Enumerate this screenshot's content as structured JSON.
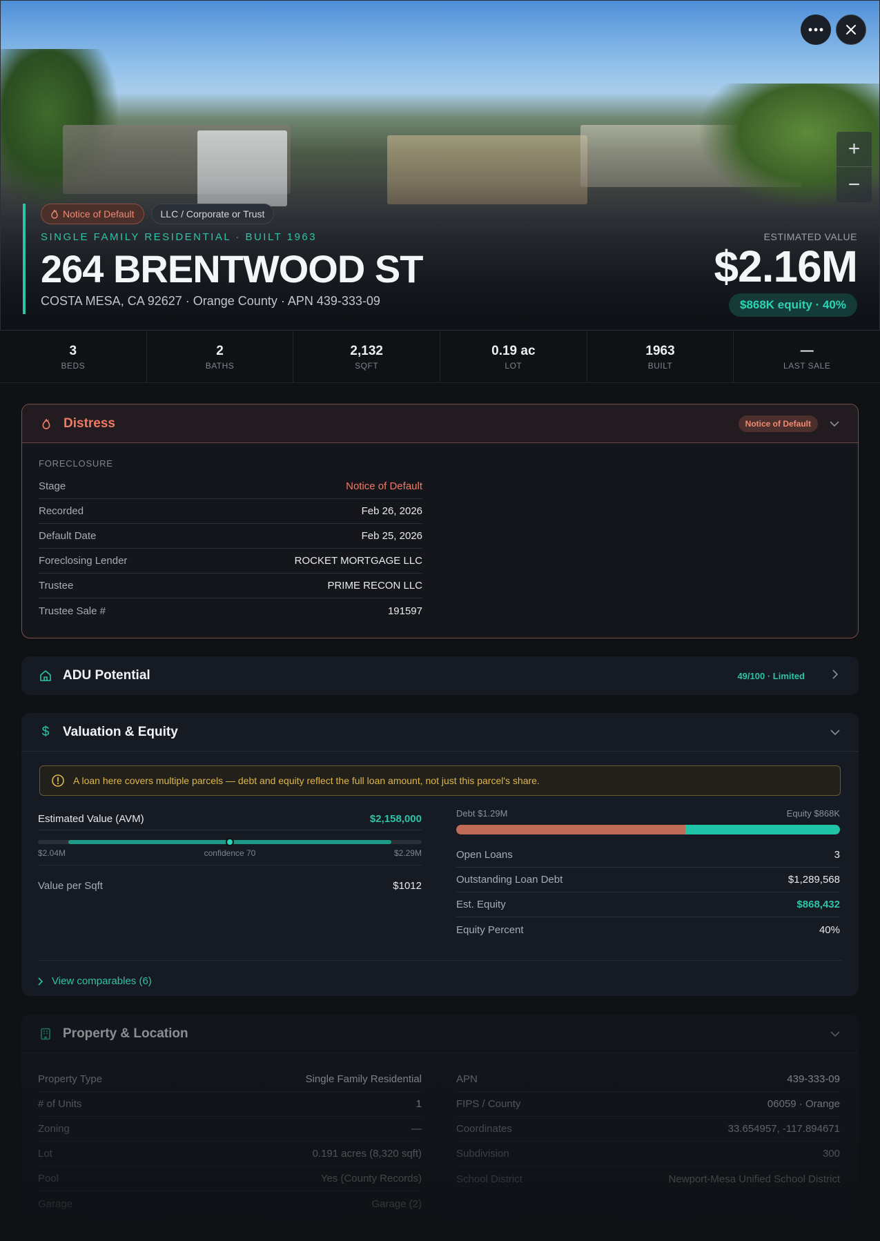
{
  "hero": {
    "badges": [
      "Notice of Default",
      "LLC / Corporate or Trust"
    ],
    "subtype": "SINGLE FAMILY RESIDENTIAL · BUILT 1963",
    "address": "264 BRENTWOOD ST",
    "location": "COSTA MESA, CA 92627 · Orange County · APN 439-333-09",
    "estimated_label": "ESTIMATED VALUE",
    "estimated_value": "$2.16M",
    "equity": "$868K equity · 40%",
    "zoom_in": "+",
    "zoom_out": "−"
  },
  "stats": [
    {
      "value": "3",
      "label": "BEDS"
    },
    {
      "value": "2",
      "label": "BATHS"
    },
    {
      "value": "2,132",
      "label": "SQFT"
    },
    {
      "value": "0.19 ac",
      "label": "LOT"
    },
    {
      "value": "1963",
      "label": "BUILT"
    },
    {
      "value": "—",
      "label": "LAST SALE"
    }
  ],
  "distress": {
    "title": "Distress",
    "badge": "Notice of Default",
    "section": "FORECLOSURE",
    "rows": [
      {
        "k": "Stage",
        "v": "Notice of Default"
      },
      {
        "k": "Recorded",
        "v": "Feb 26, 2026"
      },
      {
        "k": "Default Date",
        "v": "Feb 25, 2026"
      },
      {
        "k": "Foreclosing Lender",
        "v": "ROCKET MORTGAGE LLC"
      },
      {
        "k": "Trustee",
        "v": "PRIME RECON LLC"
      },
      {
        "k": "Trustee Sale #",
        "v": "191597"
      }
    ]
  },
  "adu": {
    "title": "ADU Potential",
    "score": "49/100 · Limited"
  },
  "valuation": {
    "title": "Valuation & Equity",
    "warning": "A loan here covers multiple parcels — debt and equity reflect the full loan amount, not just this parcel's share.",
    "avm_label": "Estimated Value (AVM)",
    "avm_value": "$2,158,000",
    "range_low": "$2.04M",
    "range_conf": "confidence 70",
    "range_high": "$2.29M",
    "per_sqft_label": "Value per Sqft",
    "per_sqft_value": "$1012",
    "debt_label": "Debt $1.29M",
    "equity_label": "Equity $868K",
    "debt_share": 0.598,
    "rows": [
      {
        "k": "Open Loans",
        "v": "3"
      },
      {
        "k": "Outstanding Loan Debt",
        "v": "$1,289,568"
      },
      {
        "k": "Est. Equity",
        "v": "$868,432"
      },
      {
        "k": "Equity Percent",
        "v": "40%"
      }
    ],
    "comparables": "View comparables (6)"
  },
  "property": {
    "title": "Property & Location",
    "left": [
      {
        "k": "Property Type",
        "v": "Single Family Residential"
      },
      {
        "k": "# of Units",
        "v": "1"
      },
      {
        "k": "Zoning",
        "v": "—"
      },
      {
        "k": "Lot",
        "v": "0.191 acres (8,320 sqft)"
      },
      {
        "k": "Pool",
        "v": "Yes (County Records)"
      },
      {
        "k": "Garage",
        "v": "Garage (2)"
      }
    ],
    "right": [
      {
        "k": "APN",
        "v": "439-333-09"
      },
      {
        "k": "FIPS / County",
        "v": "06059 · Orange"
      },
      {
        "k": "Coordinates",
        "v": "33.654957, -117.894671"
      },
      {
        "k": "Subdivision",
        "v": "300"
      },
      {
        "k": "School District",
        "v": "Newport-Mesa Unified School District"
      }
    ]
  },
  "colors": {
    "accent": "#2cc4a8",
    "danger": "#f07a62",
    "debt": "#c06a58",
    "equity": "#1fc3a5",
    "warning": "#e0b64a"
  }
}
